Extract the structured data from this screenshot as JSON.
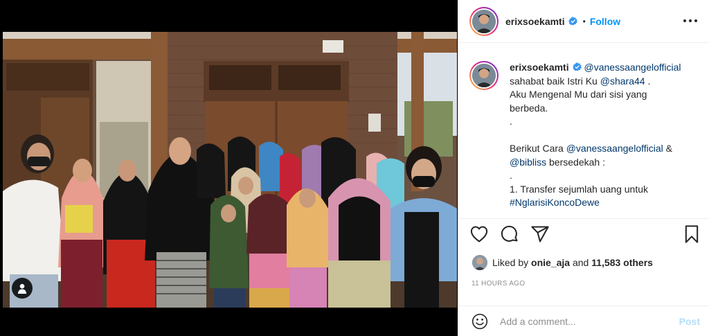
{
  "post": {
    "username": "erixsoekamti",
    "follow_label": "Follow",
    "separator": "•"
  },
  "caption": {
    "username": "erixsoekamti",
    "lines": [
      [
        "@vanessaangelofficial"
      ],
      [
        "sahabat baik Istri Ku ",
        "@shara44",
        " ."
      ],
      [
        "Aku Mengenal Mu dari sisi yang"
      ],
      [
        "berbeda."
      ],
      [
        "."
      ],
      [
        ""
      ],
      [
        "Berikut Cara ",
        "@vanessaangelofficial",
        " &"
      ],
      [
        "@bibliss",
        " bersedekah :"
      ],
      [
        "."
      ],
      [
        "1. Transfer sejumlah uang untuk"
      ],
      [
        "#NglarisiKoncoDewe"
      ]
    ],
    "line1_mention": "@vanessaangelofficial",
    "line2_text": "sahabat baik Istri Ku ",
    "line2_mention": "@shara44",
    "line2_end": " .",
    "line3": "Aku Mengenal Mu dari sisi yang",
    "line4": "berbeda.",
    "line5": ".",
    "line7_text": "Berikut Cara ",
    "line7_mention": "@vanessaangelofficial",
    "line7_end": " &",
    "line8_mention": "@bibliss",
    "line8_text": " bersedekah :",
    "line9": ".",
    "line10": "1. Transfer sejumlah uang untuk",
    "line11_tag": "#NglarisiKoncoDewe"
  },
  "likes": {
    "prefix": "Liked by ",
    "user": "onie_aja",
    "middle": " and ",
    "others": "11,583 others"
  },
  "timestamp": "11 HOURS AGO",
  "comment": {
    "placeholder": "Add a comment...",
    "post_label": "Post"
  },
  "icons": {
    "verified": "verified-badge-icon",
    "more": "more-options-icon",
    "like": "heart-icon",
    "comment": "comment-bubble-icon",
    "share": "paper-plane-icon",
    "save": "bookmark-icon",
    "emoji": "smiley-icon",
    "user_tag": "user-tag-icon"
  },
  "colors": {
    "accent": "#0095f6",
    "mention": "#00376b",
    "muted": "#8e8e8e",
    "post_disabled": "#b2dffc",
    "verified": "#3897f0"
  }
}
